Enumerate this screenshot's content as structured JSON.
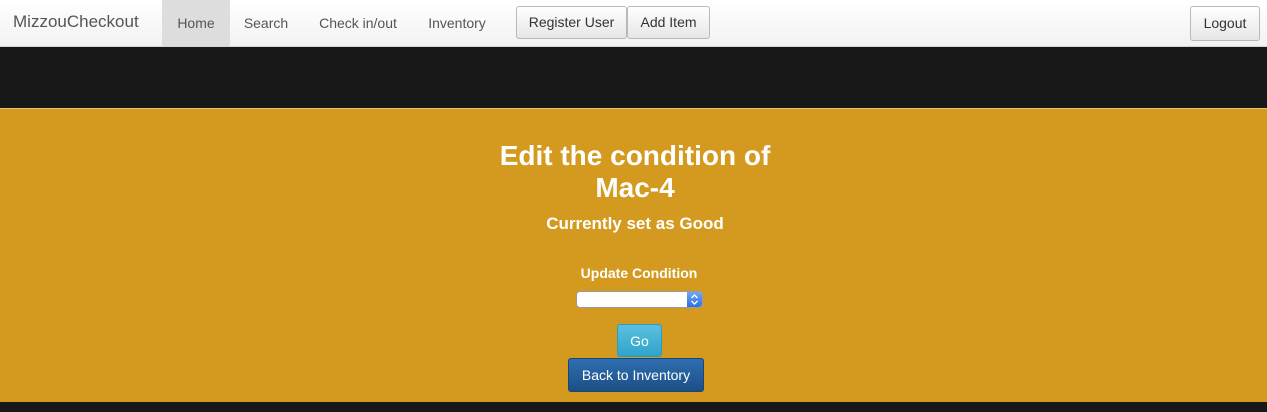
{
  "navbar": {
    "brand": "MizzouCheckout",
    "links": [
      "Home",
      "Search",
      "Check in/out",
      "Inventory"
    ],
    "register_user": "Register User",
    "add_item": "Add Item",
    "logout": "Logout"
  },
  "main": {
    "title_line1": "Edit the condition of",
    "title_line2": "Mac-4",
    "subtitle": "Currently set as Good",
    "update_label": "Update Condition",
    "select_value": "",
    "go_button": "Go",
    "back_button": "Back to Inventory"
  },
  "colors": {
    "hero_background": "#d49a1f",
    "go_button": "#5bc0de",
    "back_button": "#1d4f86",
    "dark_band": "#181818"
  }
}
